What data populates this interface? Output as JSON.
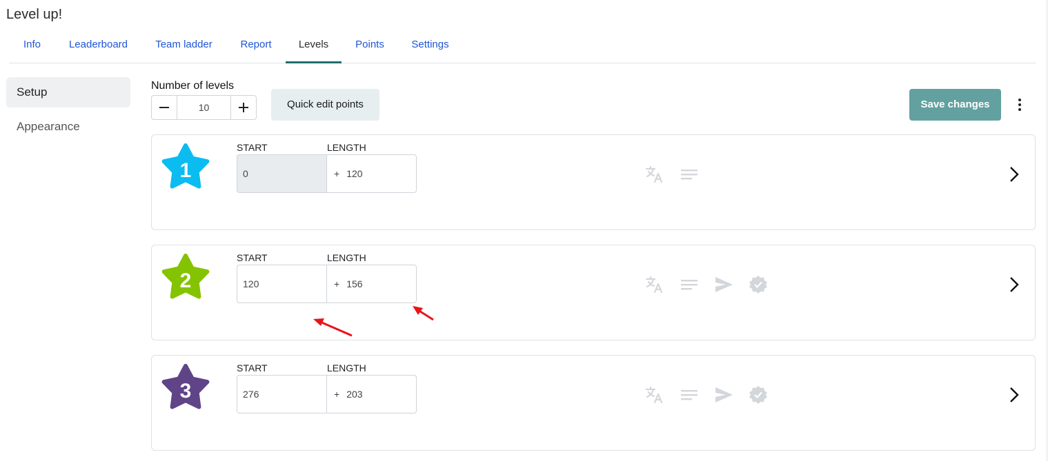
{
  "app": {
    "title": "Level up!"
  },
  "tabs": [
    {
      "label": "Info"
    },
    {
      "label": "Leaderboard"
    },
    {
      "label": "Team ladder"
    },
    {
      "label": "Report"
    },
    {
      "label": "Levels",
      "active": true
    },
    {
      "label": "Points"
    },
    {
      "label": "Settings"
    }
  ],
  "sidebar": {
    "items": [
      {
        "label": "Setup",
        "active": true
      },
      {
        "label": "Appearance"
      }
    ]
  },
  "toolbar": {
    "number_of_levels_label": "Number of levels",
    "number_of_levels_value": "10",
    "quick_edit_label": "Quick edit points",
    "save_label": "Save changes"
  },
  "field_labels": {
    "start": "START",
    "length": "LENGTH"
  },
  "levels": [
    {
      "number": "1",
      "color": "#0bbcf0",
      "start": "0",
      "plus": "+",
      "length": "120",
      "start_disabled": true,
      "icons": [
        "translate-icon",
        "description-icon"
      ]
    },
    {
      "number": "2",
      "color": "#84c300",
      "start": "120",
      "plus": "+",
      "length": "156",
      "icons": [
        "translate-icon",
        "description-icon",
        "send-icon",
        "verified-icon"
      ]
    },
    {
      "number": "3",
      "color": "#5f4487",
      "start": "276",
      "plus": "+",
      "length": "203",
      "icons": [
        "translate-icon",
        "description-icon",
        "send-icon",
        "verified-icon"
      ]
    }
  ],
  "colors": {
    "accent": "#1f6f73",
    "link": "#1f55d6",
    "save_button": "#62a19f",
    "annotation_arrow": "#e8151b",
    "icon_disabled": "#d3d6da"
  }
}
